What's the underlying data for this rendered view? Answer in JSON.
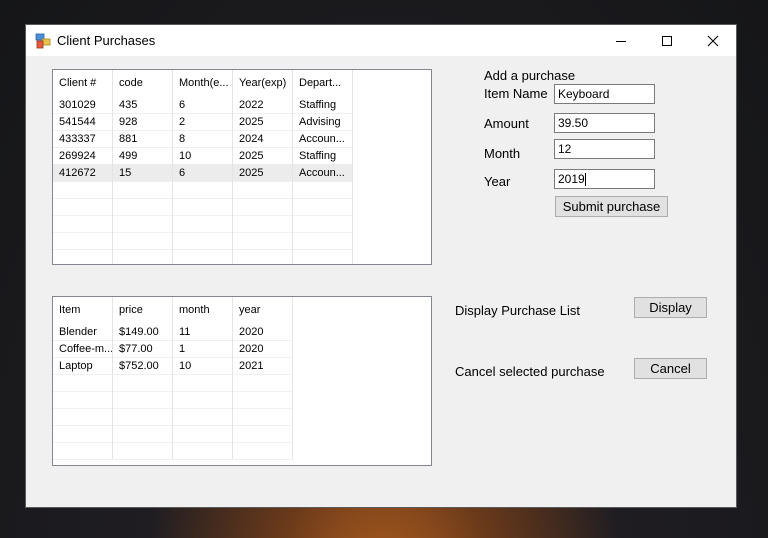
{
  "window": {
    "title": "Client Purchases"
  },
  "clients_grid": {
    "columns": [
      "Client #",
      "code",
      "Month(e...",
      "Year(exp)",
      "Depart..."
    ],
    "rows": [
      [
        "301029",
        "435",
        "6",
        "2022",
        "Staffing"
      ],
      [
        "541544",
        "928",
        "2",
        "2025",
        "Advising"
      ],
      [
        "433337",
        "881",
        "8",
        "2024",
        "Accoun..."
      ],
      [
        "269924",
        "499",
        "10",
        "2025",
        "Staffing"
      ],
      [
        "412672",
        "15",
        "6",
        "2025",
        "Accoun..."
      ]
    ],
    "selected_row": 4
  },
  "purchases_grid": {
    "columns": [
      "Item",
      "price",
      "month",
      "year"
    ],
    "rows": [
      [
        "Blender",
        "$149.00",
        "11",
        "2020"
      ],
      [
        "Coffee-m...",
        "$77.00",
        "1",
        "2020"
      ],
      [
        "Laptop",
        "$752.00",
        "10",
        "2021"
      ]
    ]
  },
  "add_purchase": {
    "heading": "Add a purchase",
    "item_name_label": "Item Name",
    "item_name_value": "Keyboard",
    "amount_label": "Amount",
    "amount_value": "39.50",
    "month_label": "Month",
    "month_value": "12",
    "year_label": "Year",
    "year_value": "2019",
    "submit_label": "Submit purchase"
  },
  "display_section": {
    "label": "Display Purchase List",
    "button_label": "Display"
  },
  "cancel_section": {
    "label": "Cancel selected purchase",
    "button_label": "Cancel"
  },
  "icons": {
    "app": "app-icon",
    "minimize": "minimize-icon",
    "maximize": "maximize-icon",
    "close": "close-icon"
  }
}
